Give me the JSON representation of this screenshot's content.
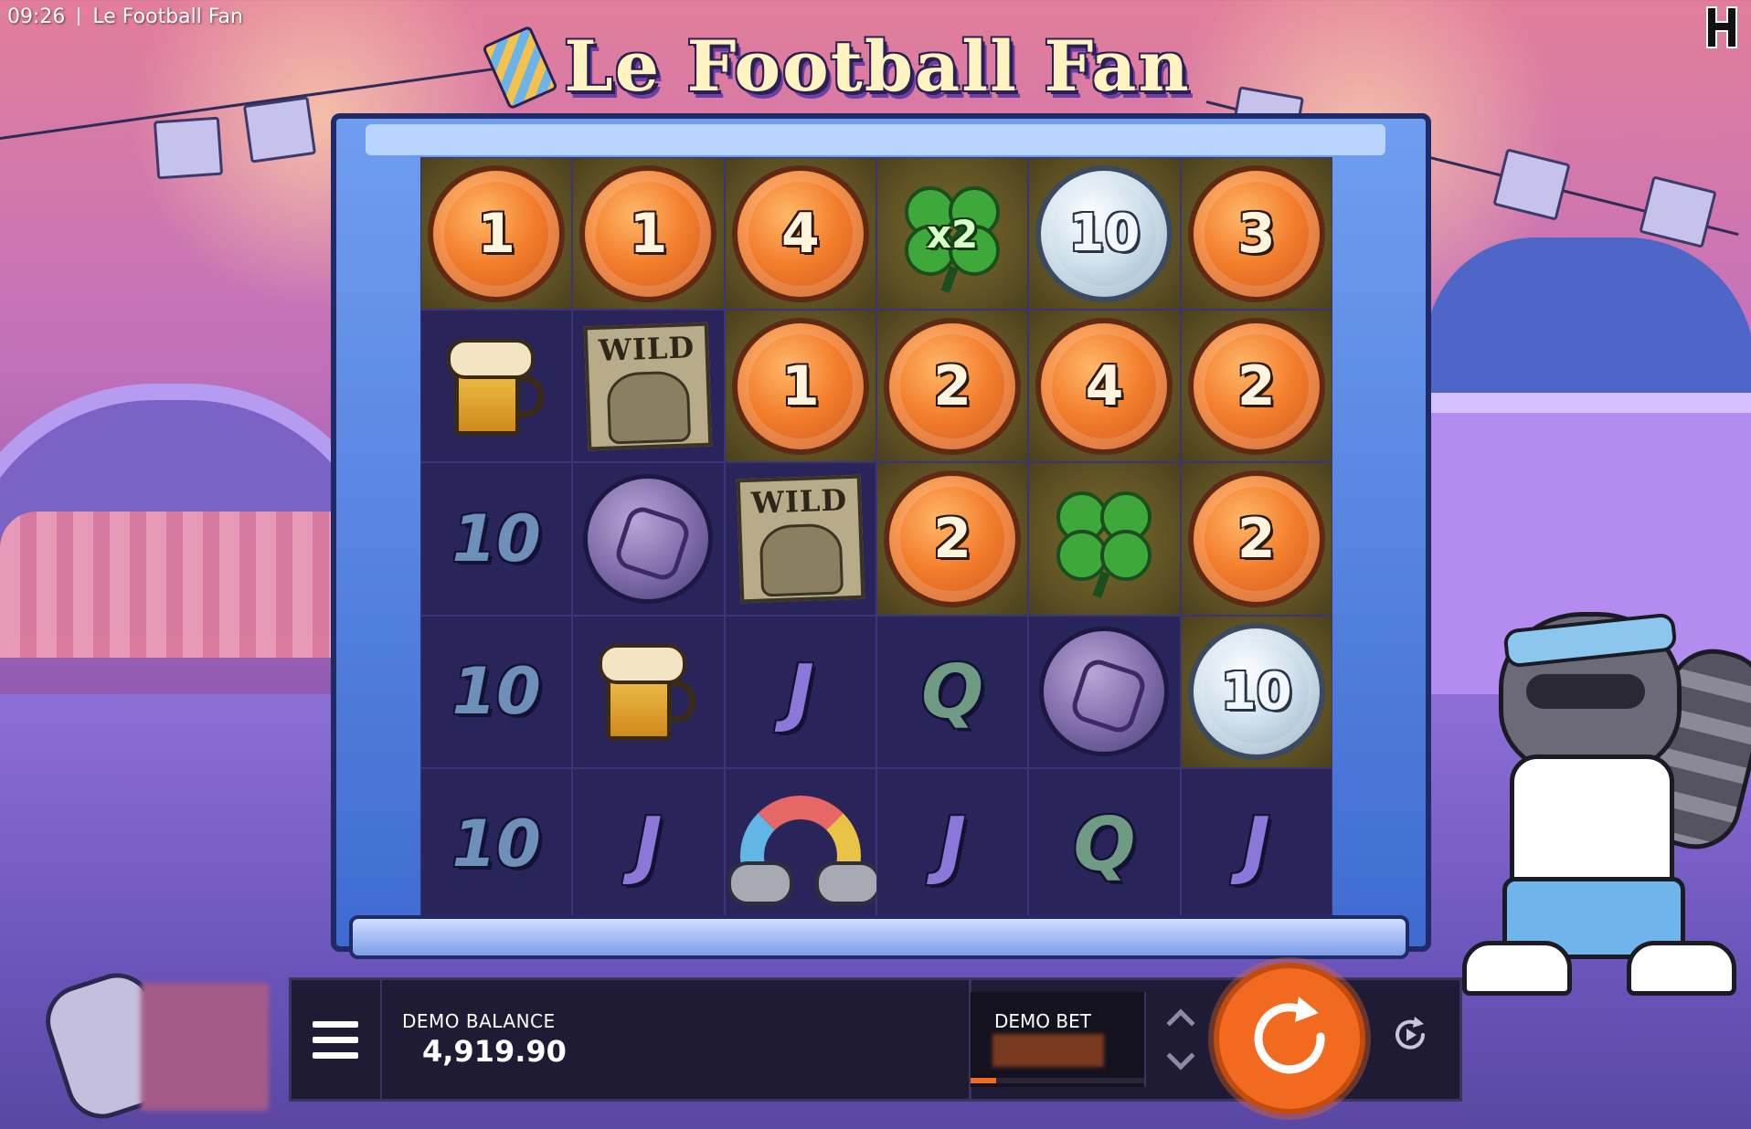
{
  "status_bar": {
    "time": "09:26",
    "app_name": "Le Football Fan"
  },
  "game": {
    "title": "Le Football Fan"
  },
  "reels": [
    [
      {
        "type": "coin",
        "value": "1",
        "bg": "gold"
      },
      {
        "type": "coin",
        "value": "1",
        "bg": "gold"
      },
      {
        "type": "coin",
        "value": "4",
        "bg": "gold"
      },
      {
        "type": "clover",
        "value": "x2",
        "bg": "gold"
      },
      {
        "type": "silver",
        "value": "10",
        "bg": "gold"
      },
      {
        "type": "coin",
        "value": "3",
        "bg": "gold"
      }
    ],
    [
      {
        "type": "beer",
        "value": "",
        "bg": "dark"
      },
      {
        "type": "wild",
        "value": "WILD",
        "bg": "dark"
      },
      {
        "type": "coin",
        "value": "1",
        "bg": "gold"
      },
      {
        "type": "coin",
        "value": "2",
        "bg": "gold"
      },
      {
        "type": "coin",
        "value": "4",
        "bg": "gold"
      },
      {
        "type": "coin",
        "value": "2",
        "bg": "gold"
      }
    ],
    [
      {
        "type": "ten",
        "value": "10",
        "bg": "dark"
      },
      {
        "type": "ball",
        "value": "",
        "bg": "dark"
      },
      {
        "type": "wild",
        "value": "WILD",
        "bg": "dark"
      },
      {
        "type": "coin",
        "value": "2",
        "bg": "gold"
      },
      {
        "type": "clover",
        "value": "",
        "bg": "gold"
      },
      {
        "type": "coin",
        "value": "2",
        "bg": "gold"
      }
    ],
    [
      {
        "type": "ten",
        "value": "10",
        "bg": "dark"
      },
      {
        "type": "beer",
        "value": "",
        "bg": "dark"
      },
      {
        "type": "j",
        "value": "J",
        "bg": "dark"
      },
      {
        "type": "q",
        "value": "Q",
        "bg": "dark"
      },
      {
        "type": "ball",
        "value": "",
        "bg": "dark"
      },
      {
        "type": "silver",
        "value": "10",
        "bg": "gold"
      }
    ],
    [
      {
        "type": "ten",
        "value": "10",
        "bg": "dark"
      },
      {
        "type": "j",
        "value": "J",
        "bg": "dark"
      },
      {
        "type": "rainbow",
        "value": "",
        "bg": "dark"
      },
      {
        "type": "j",
        "value": "J",
        "bg": "dark"
      },
      {
        "type": "q",
        "value": "Q",
        "bg": "dark"
      },
      {
        "type": "j",
        "value": "J",
        "bg": "dark"
      }
    ]
  ],
  "controls": {
    "menu_icon": "hamburger-menu-icon",
    "balance_label": "DEMO BALANCE",
    "balance_value": "4,919.90",
    "bet_label": "DEMO BET",
    "spin_icon": "spin-arrow-icon",
    "autoplay_icon": "autoplay-icon",
    "stepper_up_icon": "chevron-up-icon",
    "stepper_down_icon": "chevron-down-icon"
  },
  "colors": {
    "spin_button": "#f26a1f",
    "bar_background": "#1f1b35",
    "coin_orange": "#f37e2c",
    "coin_silver": "#cfe0ec"
  }
}
